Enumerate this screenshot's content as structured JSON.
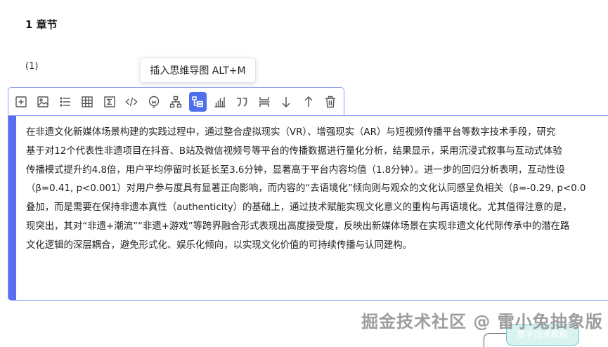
{
  "heading": {
    "chapter": "1 章节"
  },
  "paragraph": {
    "marker": "(1)"
  },
  "tooltip": {
    "text": "插入思维导图 ALT+M"
  },
  "toolbar": {
    "active_index": 8,
    "icons": [
      "plus-box-icon",
      "image-icon",
      "list-icon",
      "table-icon",
      "formula-icon",
      "code-icon",
      "idea-icon",
      "org-chart-icon",
      "mindmap-icon",
      "bar-chart-icon",
      "quote-icon",
      "page-break-icon",
      "move-down-icon",
      "move-up-icon",
      "delete-icon"
    ]
  },
  "editor": {
    "lines": [
      "在非遗文化新媒体场景构建的实践过程中，通过整合虚拟现实（VR）、增强现实（AR）与短视频传播平台等数字技术手段，研究",
      "基于对12个代表性非遗项目在抖音、B站及微信视频号等平台的传播数据进行量化分析，结果显示，采用沉浸式叙事与互动式体验",
      "传播模式提升约4.8倍，用户平均停留时长延长至3.6分钟，显著高于平台内容均值（1.8分钟）。进一步的回归分析表明，互动性设",
      "（β=0.41, p<0.001）对用户参与度具有显著正向影响，而内容的“去语境化”倾向则与观众的文化认同感呈负相关（β=-0.29, p<0.0",
      "叠加，而是需要在保持非遗本真性（authenticity）的基础上，通过技术赋能实现文化意义的重构与再语境化。尤其值得注意的是，",
      "现突出，其对“非遗+潮流”“非遗+游戏”等跨界融合形式表现出高度接受度，反映出新媒体场景在实现非遗文化代际传承中的潜在路",
      "文化逻辑的深层耦合，避免形式化、娱乐化倾向，以实现文化价值的可持续传播与认同建构。"
    ]
  },
  "watermark": {
    "text": "掘金技术社区 @ 雷小兔抽象版"
  },
  "tag_chip": {
    "text": "数字技术赋能"
  },
  "colors": {
    "accent": "#5a6df0",
    "active_button": "#4f6fea",
    "border": "#8aa3f0",
    "icon": "#555555"
  }
}
